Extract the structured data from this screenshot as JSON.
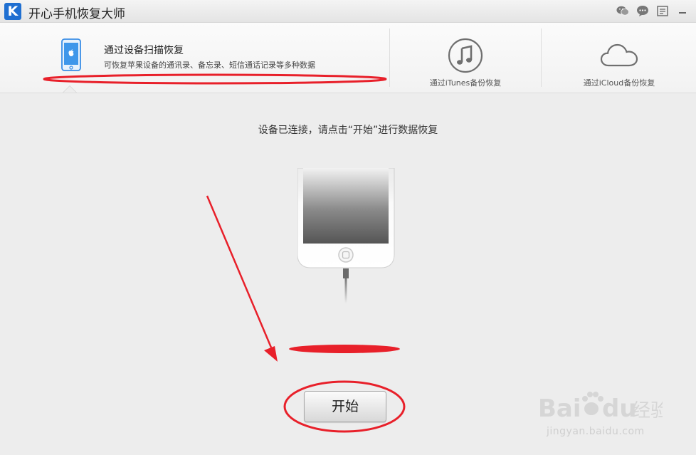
{
  "window": {
    "title": "开心手机恢复大师",
    "logo_letter": "K"
  },
  "titlebar": {
    "icons": [
      "wechat-icon",
      "chat-icon",
      "feedback-icon",
      "minimize-icon"
    ]
  },
  "tabs": [
    {
      "title": "通过设备扫描恢复",
      "description": "可恢复苹果设备的通讯录、备忘录、短信通话记录等多种数据",
      "icon": "iphone-icon",
      "selected": true
    },
    {
      "label": "通过iTunes备份恢复",
      "icon": "music-note-icon",
      "selected": false
    },
    {
      "label": "通过iCloud备份恢复",
      "icon": "cloud-icon",
      "selected": false
    }
  ],
  "main": {
    "instruction": "设备已连接，请点击“开始”进行数据恢复",
    "start_label": "开始"
  },
  "watermark": {
    "brand": "Baidu",
    "brand_cn": "经验",
    "url": "jingyan.baidu.com"
  },
  "colors": {
    "annotation_red": "#e8202a",
    "accent_blue": "#1f6fd1"
  }
}
